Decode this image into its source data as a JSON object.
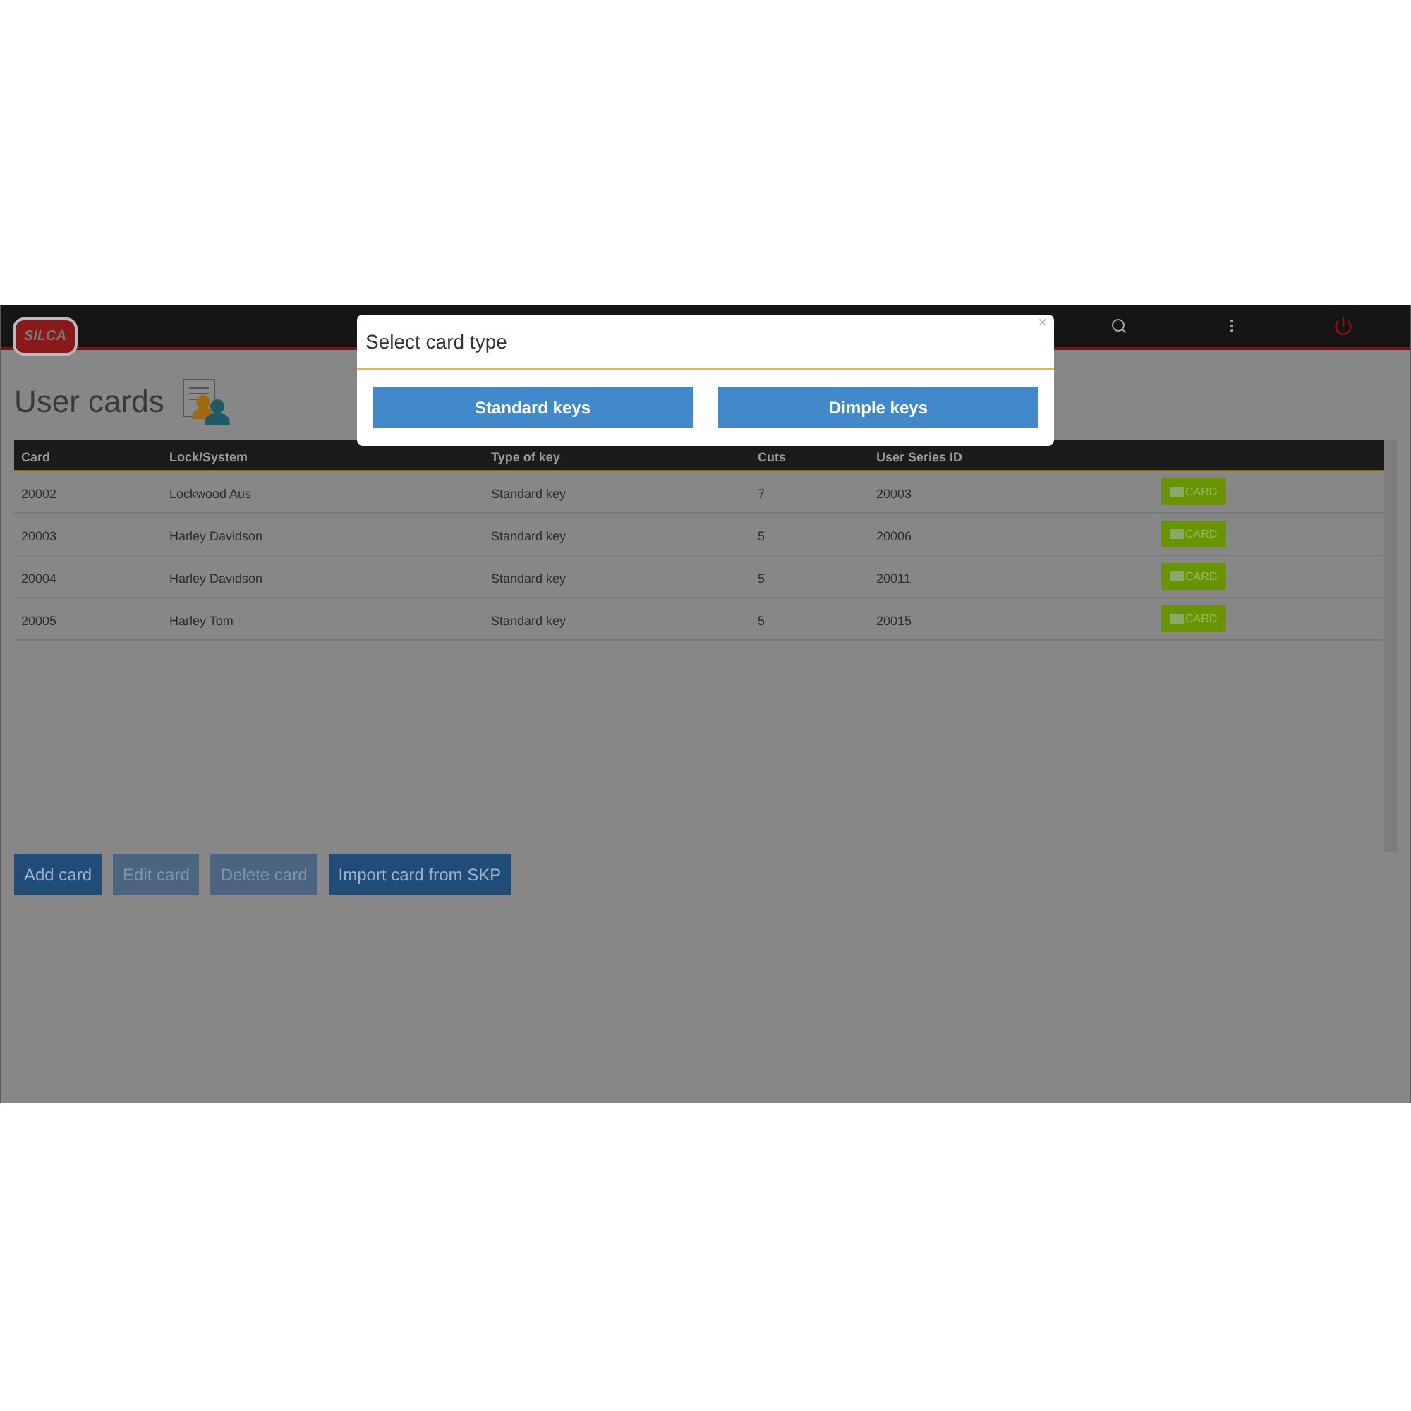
{
  "header": {
    "logo": "SILCA"
  },
  "page": {
    "title": "User cards"
  },
  "table": {
    "columns": [
      "Card",
      "Lock/System",
      "Type of key",
      "Cuts",
      "User Series ID"
    ],
    "rows": [
      {
        "cells": [
          "20002",
          "Lockwood Aus",
          "Standard key",
          "7",
          "20003"
        ],
        "action": "CARD"
      },
      {
        "cells": [
          "20003",
          "Harley Davidson",
          "Standard key",
          "5",
          "20006"
        ],
        "action": "CARD"
      },
      {
        "cells": [
          "20004",
          "Harley Davidson",
          "Standard key",
          "5",
          "20011"
        ],
        "action": "CARD"
      },
      {
        "cells": [
          "20005",
          "Harley Tom",
          "Standard key",
          "5",
          "20015"
        ],
        "action": "CARD"
      }
    ]
  },
  "buttons": [
    {
      "label": "Add card",
      "disabled": false
    },
    {
      "label": "Edit card",
      "disabled": true
    },
    {
      "label": "Delete card",
      "disabled": true
    },
    {
      "label": "Import card from SKP",
      "disabled": false
    }
  ],
  "dialog": {
    "title": "Select card type",
    "close": "×",
    "options": [
      "Standard keys",
      "Dimple keys"
    ]
  }
}
